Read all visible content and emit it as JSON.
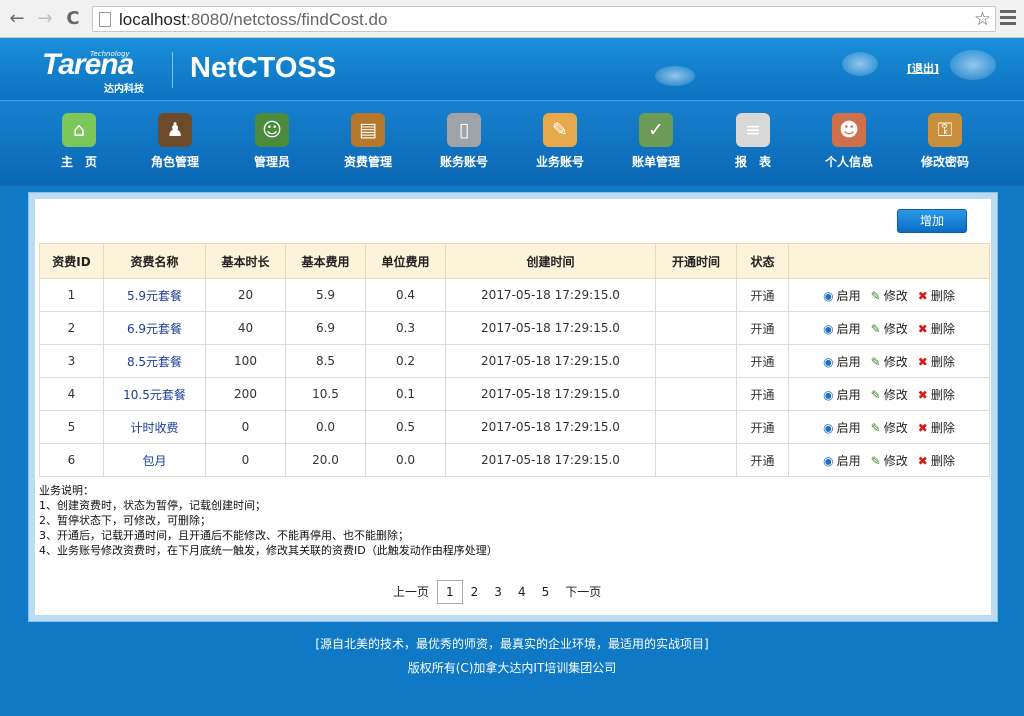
{
  "browser": {
    "url_host": "localhost",
    "url_rest": ":8080/netctoss/findCost.do",
    "back_icon": "←",
    "forward_icon": "→",
    "reload_icon": "C",
    "star_icon": "☆"
  },
  "header": {
    "brand": "Tarena",
    "brand_tech": "Technology",
    "brand_sub": "达内科技",
    "app_title": "NetCTOSS",
    "logout_label": "[退出]"
  },
  "nav": [
    {
      "label": "主　页",
      "icon": "home-icon",
      "glyph": "⌂",
      "color": "#7cc65a"
    },
    {
      "label": "角色管理",
      "icon": "role-icon",
      "glyph": "♟",
      "color": "#6b4b2a"
    },
    {
      "label": "管理员",
      "icon": "admin-icon",
      "glyph": "☺",
      "color": "#4b8b3b"
    },
    {
      "label": "资费管理",
      "icon": "cost-icon",
      "glyph": "▤",
      "color": "#b5772c"
    },
    {
      "label": "账务账号",
      "icon": "account-icon",
      "glyph": "▯",
      "color": "#9ea3a8"
    },
    {
      "label": "业务账号",
      "icon": "service-icon",
      "glyph": "✎",
      "color": "#e8a94c"
    },
    {
      "label": "账单管理",
      "icon": "bill-icon",
      "glyph": "✓",
      "color": "#6b9b57"
    },
    {
      "label": "报　表",
      "icon": "report-icon",
      "glyph": "≡",
      "color": "#d8d8d8"
    },
    {
      "label": "个人信息",
      "icon": "user-info-icon",
      "glyph": "☻",
      "color": "#d0704a"
    },
    {
      "label": "修改密码",
      "icon": "password-icon",
      "glyph": "⚿",
      "color": "#c8903c"
    }
  ],
  "toolbar": {
    "add_label": "增加"
  },
  "table": {
    "headers": [
      "资费ID",
      "资费名称",
      "基本时长",
      "基本费用",
      "单位费用",
      "创建时间",
      "开通时间",
      "状态",
      ""
    ],
    "rows": [
      {
        "id": "1",
        "name": "5.9元套餐",
        "duration": "20",
        "base_cost": "5.9",
        "unit_cost": "0.4",
        "created": "2017-05-18 17:29:15.0",
        "opened": "",
        "status": "开通"
      },
      {
        "id": "2",
        "name": "6.9元套餐",
        "duration": "40",
        "base_cost": "6.9",
        "unit_cost": "0.3",
        "created": "2017-05-18 17:29:15.0",
        "opened": "",
        "status": "开通"
      },
      {
        "id": "3",
        "name": "8.5元套餐",
        "duration": "100",
        "base_cost": "8.5",
        "unit_cost": "0.2",
        "created": "2017-05-18 17:29:15.0",
        "opened": "",
        "status": "开通"
      },
      {
        "id": "4",
        "name": "10.5元套餐",
        "duration": "200",
        "base_cost": "10.5",
        "unit_cost": "0.1",
        "created": "2017-05-18 17:29:15.0",
        "opened": "",
        "status": "开通"
      },
      {
        "id": "5",
        "name": "计时收费",
        "duration": "0",
        "base_cost": "0.0",
        "unit_cost": "0.5",
        "created": "2017-05-18 17:29:15.0",
        "opened": "",
        "status": "开通"
      },
      {
        "id": "6",
        "name": "包月",
        "duration": "0",
        "base_cost": "20.0",
        "unit_cost": "0.0",
        "created": "2017-05-18 17:29:15.0",
        "opened": "",
        "status": "开通"
      }
    ],
    "actions": {
      "enable": "启用",
      "edit": "修改",
      "delete": "删除"
    }
  },
  "notes": [
    "业务说明：",
    "1、创建资费时，状态为暂停，记载创建时间；",
    "2、暂停状态下，可修改，可删除；",
    "3、开通后，记载开通时间，且开通后不能修改、不能再停用、也不能删除；",
    "4、业务账号修改资费时，在下月底统一触发，修改其关联的资费ID（此触发动作由程序处理）"
  ],
  "pager": {
    "prev": "上一页",
    "pages": [
      "1",
      "2",
      "3",
      "4",
      "5"
    ],
    "current": "1",
    "next": "下一页"
  },
  "footer": {
    "line1": "[源自北美的技术，最优秀的师资，最真实的企业环境，最适用的实战项目]",
    "line2": "版权所有(C)加拿大达内IT培训集团公司"
  }
}
